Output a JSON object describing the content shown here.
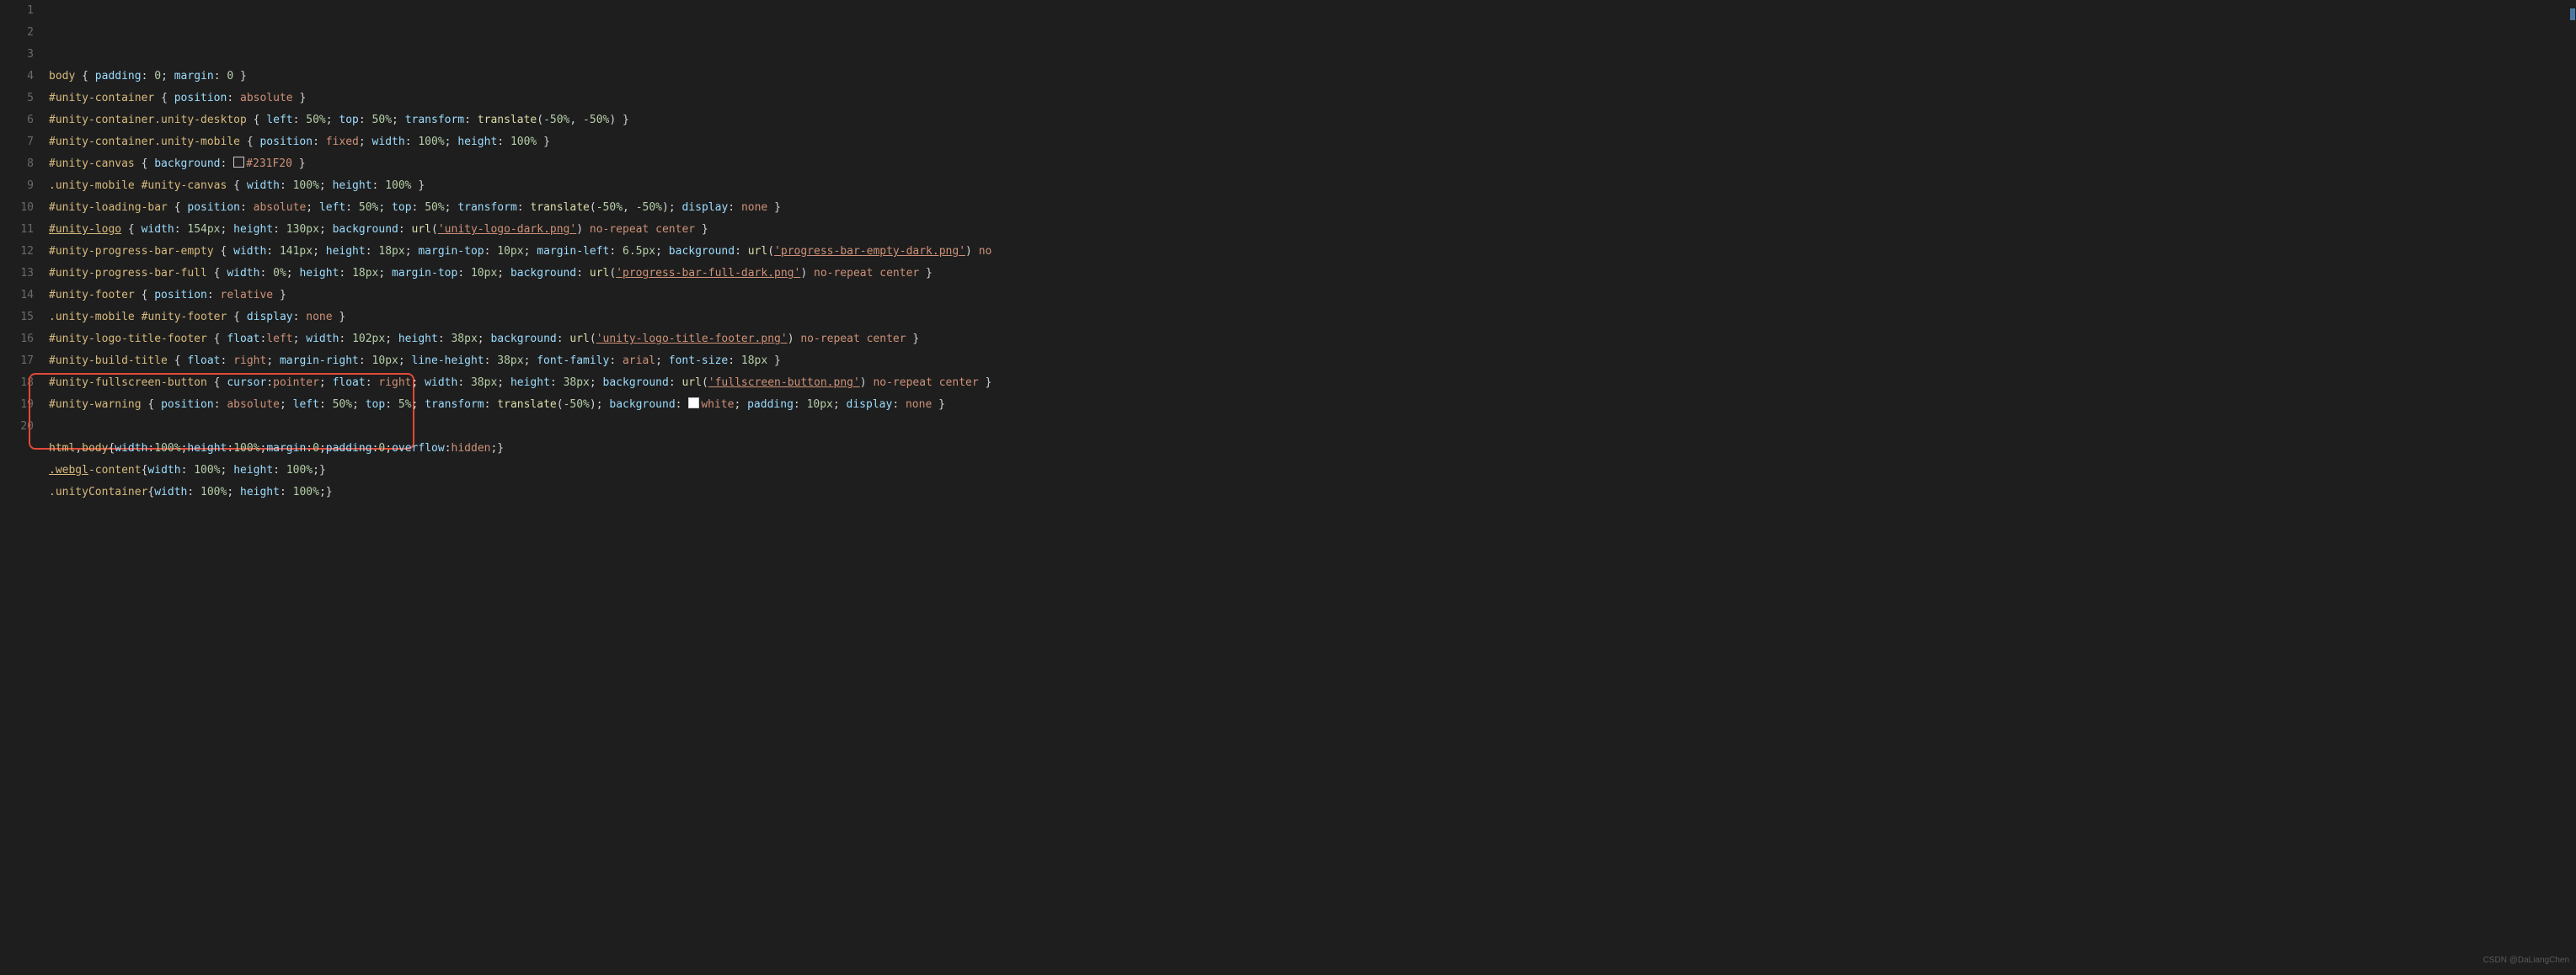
{
  "watermark": "CSDN @DaLiangChen",
  "lines": [
    {
      "n": 1,
      "tokens": [
        [
          "sel",
          "body "
        ],
        [
          "punc",
          "{ "
        ],
        [
          "prop",
          "padding"
        ],
        [
          "punc",
          ": "
        ],
        [
          "num",
          "0"
        ],
        [
          "punc",
          "; "
        ],
        [
          "prop",
          "margin"
        ],
        [
          "punc",
          ": "
        ],
        [
          "num",
          "0"
        ],
        [
          "punc",
          " }"
        ]
      ]
    },
    {
      "n": 2,
      "tokens": [
        [
          "sel",
          "#unity-container "
        ],
        [
          "punc",
          "{ "
        ],
        [
          "prop",
          "position"
        ],
        [
          "punc",
          ": "
        ],
        [
          "val",
          "absolute"
        ],
        [
          "punc",
          " }"
        ]
      ]
    },
    {
      "n": 3,
      "tokens": [
        [
          "sel",
          "#unity-container.unity-desktop "
        ],
        [
          "punc",
          "{ "
        ],
        [
          "prop",
          "left"
        ],
        [
          "punc",
          ": "
        ],
        [
          "num",
          "50%"
        ],
        [
          "punc",
          "; "
        ],
        [
          "prop",
          "top"
        ],
        [
          "punc",
          ": "
        ],
        [
          "num",
          "50%"
        ],
        [
          "punc",
          "; "
        ],
        [
          "prop",
          "transform"
        ],
        [
          "punc",
          ": "
        ],
        [
          "func",
          "translate"
        ],
        [
          "punc",
          "("
        ],
        [
          "num",
          "-50%"
        ],
        [
          "punc",
          ", "
        ],
        [
          "num",
          "-50%"
        ],
        [
          "punc",
          ") }"
        ]
      ]
    },
    {
      "n": 4,
      "tokens": [
        [
          "sel",
          "#unity-container.unity-mobile "
        ],
        [
          "punc",
          "{ "
        ],
        [
          "prop",
          "position"
        ],
        [
          "punc",
          ": "
        ],
        [
          "val",
          "fixed"
        ],
        [
          "punc",
          "; "
        ],
        [
          "prop",
          "width"
        ],
        [
          "punc",
          ": "
        ],
        [
          "num",
          "100%"
        ],
        [
          "punc",
          "; "
        ],
        [
          "prop",
          "height"
        ],
        [
          "punc",
          ": "
        ],
        [
          "num",
          "100%"
        ],
        [
          "punc",
          " }"
        ]
      ]
    },
    {
      "n": 5,
      "tokens": [
        [
          "sel",
          "#unity-canvas "
        ],
        [
          "punc",
          "{ "
        ],
        [
          "prop",
          "background"
        ],
        [
          "punc",
          ": "
        ],
        [
          "color",
          "#231F20"
        ],
        [
          "val",
          "#231F20"
        ],
        [
          "punc",
          " }"
        ]
      ]
    },
    {
      "n": 6,
      "tokens": [
        [
          "sel",
          ".unity-mobile #unity-canvas "
        ],
        [
          "punc",
          "{ "
        ],
        [
          "prop",
          "width"
        ],
        [
          "punc",
          ": "
        ],
        [
          "num",
          "100%"
        ],
        [
          "punc",
          "; "
        ],
        [
          "prop",
          "height"
        ],
        [
          "punc",
          ": "
        ],
        [
          "num",
          "100%"
        ],
        [
          "punc",
          " }"
        ]
      ]
    },
    {
      "n": 7,
      "tokens": [
        [
          "sel",
          "#unity-loading-bar "
        ],
        [
          "punc",
          "{ "
        ],
        [
          "prop",
          "position"
        ],
        [
          "punc",
          ": "
        ],
        [
          "val",
          "absolute"
        ],
        [
          "punc",
          "; "
        ],
        [
          "prop",
          "left"
        ],
        [
          "punc",
          ": "
        ],
        [
          "num",
          "50%"
        ],
        [
          "punc",
          "; "
        ],
        [
          "prop",
          "top"
        ],
        [
          "punc",
          ": "
        ],
        [
          "num",
          "50%"
        ],
        [
          "punc",
          "; "
        ],
        [
          "prop",
          "transform"
        ],
        [
          "punc",
          ": "
        ],
        [
          "func",
          "translate"
        ],
        [
          "punc",
          "("
        ],
        [
          "num",
          "-50%"
        ],
        [
          "punc",
          ", "
        ],
        [
          "num",
          "-50%"
        ],
        [
          "punc",
          "); "
        ],
        [
          "prop",
          "display"
        ],
        [
          "punc",
          ": "
        ],
        [
          "val",
          "none"
        ],
        [
          "punc",
          " }"
        ]
      ]
    },
    {
      "n": 8,
      "tokens": [
        [
          "sellink",
          "#unity-logo"
        ],
        [
          "punc",
          " { "
        ],
        [
          "prop",
          "width"
        ],
        [
          "punc",
          ": "
        ],
        [
          "num",
          "154px"
        ],
        [
          "punc",
          "; "
        ],
        [
          "prop",
          "height"
        ],
        [
          "punc",
          ": "
        ],
        [
          "num",
          "130px"
        ],
        [
          "punc",
          "; "
        ],
        [
          "prop",
          "background"
        ],
        [
          "punc",
          ": "
        ],
        [
          "func",
          "url"
        ],
        [
          "punc",
          "("
        ],
        [
          "strlink",
          "'unity-logo-dark.png'"
        ],
        [
          "punc",
          ") "
        ],
        [
          "val",
          "no-repeat center"
        ],
        [
          "punc",
          " }"
        ]
      ]
    },
    {
      "n": 9,
      "tokens": [
        [
          "sel",
          "#unity-progress-bar-empty "
        ],
        [
          "punc",
          "{ "
        ],
        [
          "prop",
          "width"
        ],
        [
          "punc",
          ": "
        ],
        [
          "num",
          "141px"
        ],
        [
          "punc",
          "; "
        ],
        [
          "prop",
          "height"
        ],
        [
          "punc",
          ": "
        ],
        [
          "num",
          "18px"
        ],
        [
          "punc",
          "; "
        ],
        [
          "prop",
          "margin-top"
        ],
        [
          "punc",
          ": "
        ],
        [
          "num",
          "10px"
        ],
        [
          "punc",
          "; "
        ],
        [
          "prop",
          "margin-left"
        ],
        [
          "punc",
          ": "
        ],
        [
          "num",
          "6.5px"
        ],
        [
          "punc",
          "; "
        ],
        [
          "prop",
          "background"
        ],
        [
          "punc",
          ": "
        ],
        [
          "func",
          "url"
        ],
        [
          "punc",
          "("
        ],
        [
          "strlink",
          "'progress-bar-empty-dark.png'"
        ],
        [
          "punc",
          ") "
        ],
        [
          "val",
          "no"
        ]
      ]
    },
    {
      "n": 10,
      "tokens": [
        [
          "sel",
          "#unity-progress-bar-full "
        ],
        [
          "punc",
          "{ "
        ],
        [
          "prop",
          "width"
        ],
        [
          "punc",
          ": "
        ],
        [
          "num",
          "0%"
        ],
        [
          "punc",
          "; "
        ],
        [
          "prop",
          "height"
        ],
        [
          "punc",
          ": "
        ],
        [
          "num",
          "18px"
        ],
        [
          "punc",
          "; "
        ],
        [
          "prop",
          "margin-top"
        ],
        [
          "punc",
          ": "
        ],
        [
          "num",
          "10px"
        ],
        [
          "punc",
          "; "
        ],
        [
          "prop",
          "background"
        ],
        [
          "punc",
          ": "
        ],
        [
          "func",
          "url"
        ],
        [
          "punc",
          "("
        ],
        [
          "strlink",
          "'progress-bar-full-dark.png'"
        ],
        [
          "punc",
          ") "
        ],
        [
          "val",
          "no-repeat center"
        ],
        [
          "punc",
          " }"
        ]
      ]
    },
    {
      "n": 11,
      "tokens": [
        [
          "sel",
          "#unity-footer "
        ],
        [
          "punc",
          "{ "
        ],
        [
          "prop",
          "position"
        ],
        [
          "punc",
          ": "
        ],
        [
          "val",
          "relative"
        ],
        [
          "punc",
          " }"
        ]
      ]
    },
    {
      "n": 12,
      "tokens": [
        [
          "sel",
          ".unity-mobile #unity-footer "
        ],
        [
          "punc",
          "{ "
        ],
        [
          "prop",
          "display"
        ],
        [
          "punc",
          ": "
        ],
        [
          "val",
          "none"
        ],
        [
          "punc",
          " }"
        ]
      ]
    },
    {
      "n": 13,
      "tokens": [
        [
          "sel",
          "#unity-logo-title-footer "
        ],
        [
          "punc",
          "{ "
        ],
        [
          "prop",
          "float"
        ],
        [
          "punc",
          ":"
        ],
        [
          "val",
          "left"
        ],
        [
          "punc",
          "; "
        ],
        [
          "prop",
          "width"
        ],
        [
          "punc",
          ": "
        ],
        [
          "num",
          "102px"
        ],
        [
          "punc",
          "; "
        ],
        [
          "prop",
          "height"
        ],
        [
          "punc",
          ": "
        ],
        [
          "num",
          "38px"
        ],
        [
          "punc",
          "; "
        ],
        [
          "prop",
          "background"
        ],
        [
          "punc",
          ": "
        ],
        [
          "func",
          "url"
        ],
        [
          "punc",
          "("
        ],
        [
          "strlink",
          "'unity-logo-title-footer.png'"
        ],
        [
          "punc",
          ") "
        ],
        [
          "val",
          "no-repeat center"
        ],
        [
          "punc",
          " }"
        ]
      ]
    },
    {
      "n": 14,
      "tokens": [
        [
          "sel",
          "#unity-build-title "
        ],
        [
          "punc",
          "{ "
        ],
        [
          "prop",
          "float"
        ],
        [
          "punc",
          ": "
        ],
        [
          "val",
          "right"
        ],
        [
          "punc",
          "; "
        ],
        [
          "prop",
          "margin-right"
        ],
        [
          "punc",
          ": "
        ],
        [
          "num",
          "10px"
        ],
        [
          "punc",
          "; "
        ],
        [
          "prop",
          "line-height"
        ],
        [
          "punc",
          ": "
        ],
        [
          "num",
          "38px"
        ],
        [
          "punc",
          "; "
        ],
        [
          "prop",
          "font-family"
        ],
        [
          "punc",
          ": "
        ],
        [
          "val",
          "arial"
        ],
        [
          "punc",
          "; "
        ],
        [
          "prop",
          "font-size"
        ],
        [
          "punc",
          ": "
        ],
        [
          "num",
          "18px"
        ],
        [
          "punc",
          " }"
        ]
      ]
    },
    {
      "n": 15,
      "tokens": [
        [
          "sel",
          "#unity-fullscreen-button "
        ],
        [
          "punc",
          "{ "
        ],
        [
          "prop",
          "cursor"
        ],
        [
          "punc",
          ":"
        ],
        [
          "val",
          "pointer"
        ],
        [
          "punc",
          "; "
        ],
        [
          "prop",
          "float"
        ],
        [
          "punc",
          ": "
        ],
        [
          "val",
          "right"
        ],
        [
          "punc",
          "; "
        ],
        [
          "prop",
          "width"
        ],
        [
          "punc",
          ": "
        ],
        [
          "num",
          "38px"
        ],
        [
          "punc",
          "; "
        ],
        [
          "prop",
          "height"
        ],
        [
          "punc",
          ": "
        ],
        [
          "num",
          "38px"
        ],
        [
          "punc",
          "; "
        ],
        [
          "prop",
          "background"
        ],
        [
          "punc",
          ": "
        ],
        [
          "func",
          "url"
        ],
        [
          "punc",
          "("
        ],
        [
          "strlink",
          "'fullscreen-button.png'"
        ],
        [
          "punc",
          ") "
        ],
        [
          "val",
          "no-repeat center"
        ],
        [
          "punc",
          " }"
        ]
      ]
    },
    {
      "n": 16,
      "tokens": [
        [
          "sel",
          "#unity-warning "
        ],
        [
          "punc",
          "{ "
        ],
        [
          "prop",
          "position"
        ],
        [
          "punc",
          ": "
        ],
        [
          "val",
          "absolute"
        ],
        [
          "punc",
          "; "
        ],
        [
          "prop",
          "left"
        ],
        [
          "punc",
          ": "
        ],
        [
          "num",
          "50%"
        ],
        [
          "punc",
          "; "
        ],
        [
          "prop",
          "top"
        ],
        [
          "punc",
          ": "
        ],
        [
          "num",
          "5%"
        ],
        [
          "punc",
          "; "
        ],
        [
          "prop",
          "transform"
        ],
        [
          "punc",
          ": "
        ],
        [
          "func",
          "translate"
        ],
        [
          "punc",
          "("
        ],
        [
          "num",
          "-50%"
        ],
        [
          "punc",
          "); "
        ],
        [
          "prop",
          "background"
        ],
        [
          "punc",
          ": "
        ],
        [
          "color",
          "#ffffff"
        ],
        [
          "val",
          "white"
        ],
        [
          "punc",
          "; "
        ],
        [
          "prop",
          "padding"
        ],
        [
          "punc",
          ": "
        ],
        [
          "num",
          "10px"
        ],
        [
          "punc",
          "; "
        ],
        [
          "prop",
          "display"
        ],
        [
          "punc",
          ": "
        ],
        [
          "val",
          "none"
        ],
        [
          "punc",
          " }"
        ]
      ]
    },
    {
      "n": 17,
      "tokens": []
    },
    {
      "n": 18,
      "tokens": [
        [
          "sel",
          "html"
        ],
        [
          "punc",
          ","
        ],
        [
          "sel",
          "body"
        ],
        [
          "punc",
          "{"
        ],
        [
          "prop",
          "width"
        ],
        [
          "punc",
          ":"
        ],
        [
          "num",
          "100%"
        ],
        [
          "punc",
          ";"
        ],
        [
          "prop",
          "height"
        ],
        [
          "punc",
          ":"
        ],
        [
          "num",
          "100%"
        ],
        [
          "punc",
          ";"
        ],
        [
          "prop",
          "margin"
        ],
        [
          "punc",
          ":"
        ],
        [
          "num",
          "0"
        ],
        [
          "punc",
          ";"
        ],
        [
          "prop",
          "padding"
        ],
        [
          "punc",
          ":"
        ],
        [
          "num",
          "0"
        ],
        [
          "punc",
          ";"
        ],
        [
          "prop",
          "overflow"
        ],
        [
          "punc",
          ":"
        ],
        [
          "val",
          "hidden"
        ],
        [
          "punc",
          ";}"
        ]
      ]
    },
    {
      "n": 19,
      "tokens": [
        [
          "sellink",
          ".webgl"
        ],
        [
          "sel",
          "-content"
        ],
        [
          "punc",
          "{"
        ],
        [
          "prop",
          "width"
        ],
        [
          "punc",
          ": "
        ],
        [
          "num",
          "100%"
        ],
        [
          "punc",
          "; "
        ],
        [
          "prop",
          "height"
        ],
        [
          "punc",
          ": "
        ],
        [
          "num",
          "100%"
        ],
        [
          "punc",
          ";}"
        ]
      ]
    },
    {
      "n": 20,
      "tokens": [
        [
          "sel",
          ".unityContainer"
        ],
        [
          "punc",
          "{"
        ],
        [
          "prop",
          "width"
        ],
        [
          "punc",
          ": "
        ],
        [
          "num",
          "100%"
        ],
        [
          "punc",
          "; "
        ],
        [
          "prop",
          "height"
        ],
        [
          "punc",
          ": "
        ],
        [
          "num",
          "100%"
        ],
        [
          "punc",
          ";}"
        ]
      ]
    }
  ]
}
